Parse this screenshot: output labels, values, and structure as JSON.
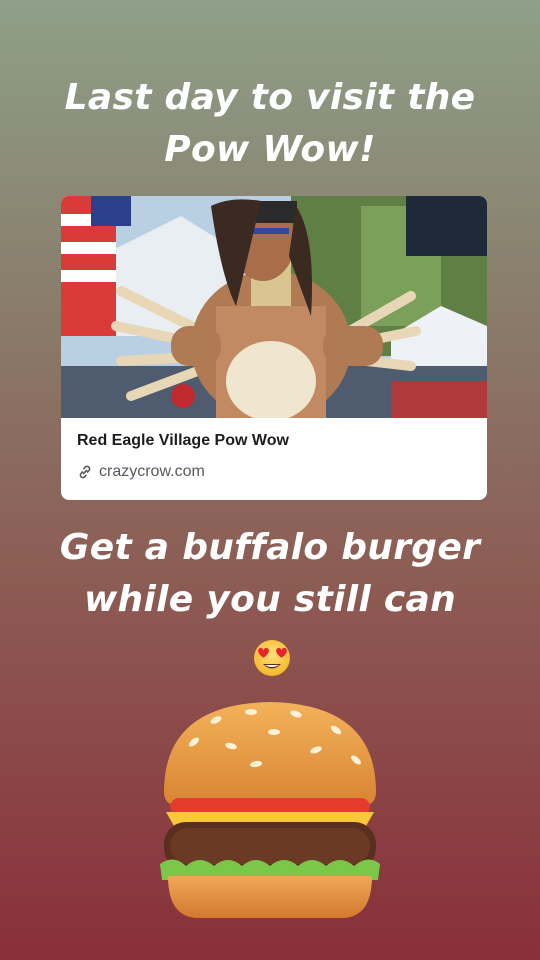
{
  "story": {
    "headline_top": [
      "Last day to visit the",
      "Pow Wow!"
    ],
    "headline_bottom": [
      "Get a buffalo burger",
      "while you still can"
    ]
  },
  "link_card": {
    "title": "Red Eagle Village Pow Wow",
    "domain": "crazycrow.com",
    "link_icon": "link-icon"
  },
  "emojis": [
    "heart-eyes-emoji",
    "hamburger-emoji"
  ],
  "colors": {
    "gradient_top": "#8ea089",
    "gradient_bottom": "#8a2f3a",
    "text": "#ffffff",
    "card_bg": "#ffffff"
  }
}
